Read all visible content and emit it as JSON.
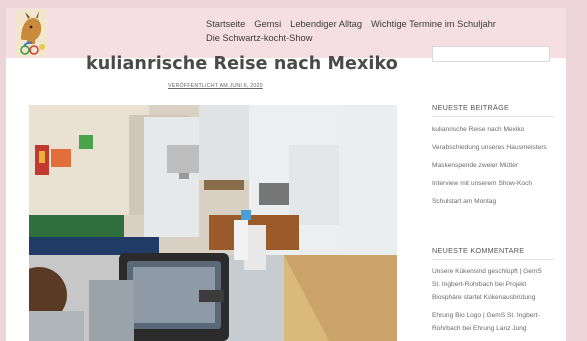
{
  "nav": {
    "items": [
      "Startseite",
      "Gemsi",
      "Lebendiger Alltag",
      "Wichtige Termine im Schuljahr"
    ],
    "item_row2": "Die Schwartz-kocht-Show"
  },
  "post": {
    "title": "kulianrische Reise nach Mexiko",
    "meta": "VERÖFFENTLICHT AM JUNI 6, 2020"
  },
  "sidebar": {
    "recent_posts_heading": "NEUESTE BEITRÄGE",
    "recent_posts": [
      "kulianrische Reise nach Mexiko",
      "Verabschiedung unseres Hausmeisters",
      "Maskenspende zweier Mütter",
      "Interview mit unserem Show-Koch",
      "Schulstart am Montag"
    ],
    "recent_comments_heading": "NEUESTE KOMMENTARE",
    "recent_comments_lines": [
      "Unsere Kükensind geschlüpft | GemS",
      "St. Ingbert-Rohrbach bei Projekt",
      "Biosphäre startet Kükenausbrütung",
      "Ehrung Bio Logo | GemS St. Ingbert-",
      "Rohrbach bei Ehrung Lanz Jung"
    ]
  },
  "colors": {
    "navbar_bg": "#f6dfe2",
    "page_frame": "#f3dde0"
  }
}
